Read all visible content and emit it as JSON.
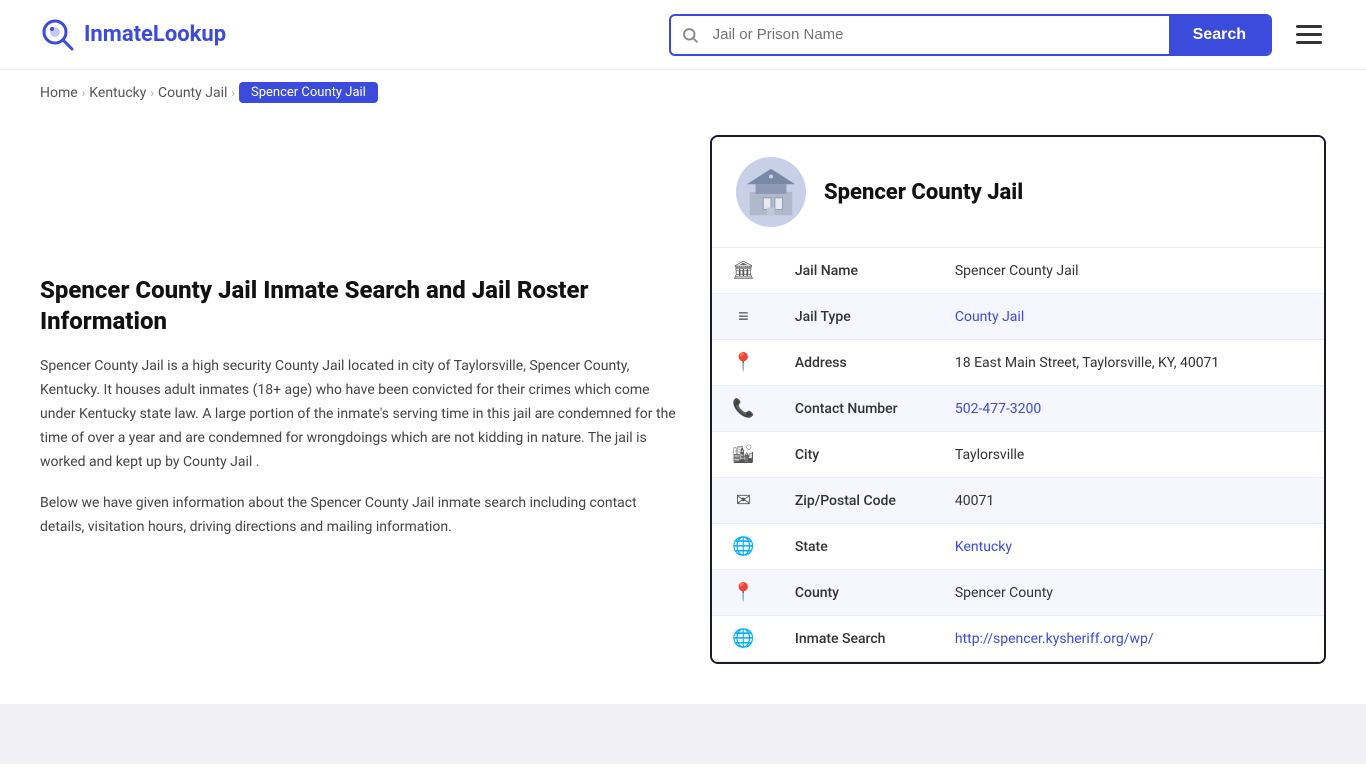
{
  "header": {
    "logo_text_part1": "Inmate",
    "logo_text_part2": "Lookup",
    "search_placeholder": "Jail or Prison Name",
    "search_button_label": "Search"
  },
  "breadcrumb": {
    "home": "Home",
    "state": "Kentucky",
    "type": "County Jail",
    "current": "Spencer County Jail"
  },
  "left": {
    "page_title": "Spencer County Jail Inmate Search and Jail Roster Information",
    "description1": "Spencer County Jail is a high security County Jail located in city of Taylorsville, Spencer County, Kentucky. It houses adult inmates (18+ age) who have been convicted for their crimes which come under Kentucky state law. A large portion of the inmate's serving time in this jail are condemned for the time of over a year and are condemned for wrongdoings which are not kidding in nature. The jail is worked and kept up by County Jail .",
    "description2": "Below we have given information about the Spencer County Jail inmate search including contact details, visitation hours, driving directions and mailing information."
  },
  "card": {
    "title": "Spencer County Jail",
    "rows": [
      {
        "icon": "🏛",
        "label": "Jail Name",
        "value": "Spencer County Jail",
        "link": null
      },
      {
        "icon": "≡",
        "label": "Jail Type",
        "value": "County Jail",
        "link": "#"
      },
      {
        "icon": "📍",
        "label": "Address",
        "value": "18 East Main Street, Taylorsville, KY, 40071",
        "link": null
      },
      {
        "icon": "📞",
        "label": "Contact Number",
        "value": "502-477-3200",
        "link": "tel:502-477-3200"
      },
      {
        "icon": "🏙",
        "label": "City",
        "value": "Taylorsville",
        "link": null
      },
      {
        "icon": "✉",
        "label": "Zip/Postal Code",
        "value": "40071",
        "link": null
      },
      {
        "icon": "🌐",
        "label": "State",
        "value": "Kentucky",
        "link": "#"
      },
      {
        "icon": "📍",
        "label": "County",
        "value": "Spencer County",
        "link": null
      },
      {
        "icon": "🌐",
        "label": "Inmate Search",
        "value": "http://spencer.kysheriff.org/wp/",
        "link": "http://spencer.kysheriff.org/wp/"
      }
    ]
  }
}
